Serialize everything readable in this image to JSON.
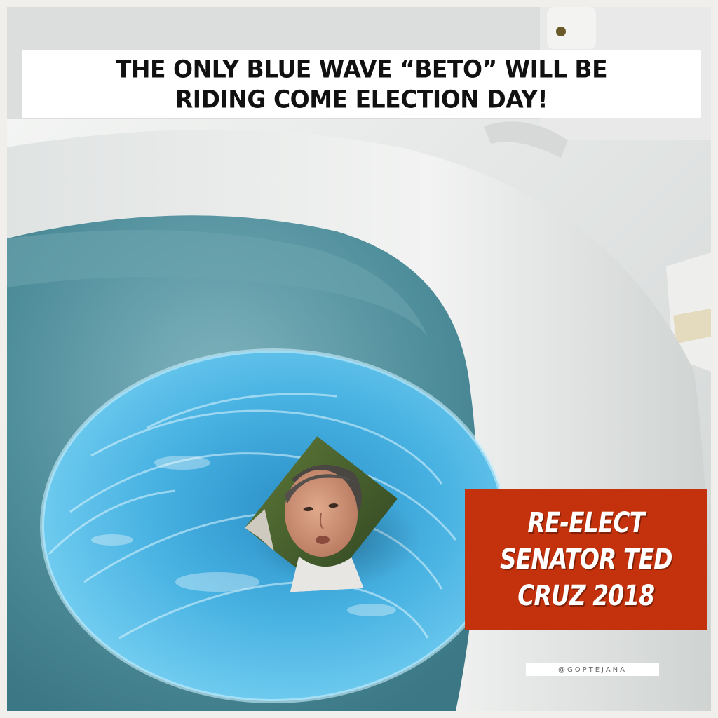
{
  "headline": {
    "text": "THE ONLY BLUE WAVE “BETO” WILL BE\nRIDING COME ELECTION DAY!"
  },
  "campaign": {
    "text": "RE-ELECT\nSENATOR TED\nCRUZ 2018",
    "background_color": "#c3320c",
    "text_color": "#ffffff"
  },
  "credit": {
    "text": "@GOPTEJANA"
  },
  "colors": {
    "water_blue": "#3aa6d8",
    "bowl_teal": "#5e9aa6",
    "porcelain": "#e9ebea"
  }
}
